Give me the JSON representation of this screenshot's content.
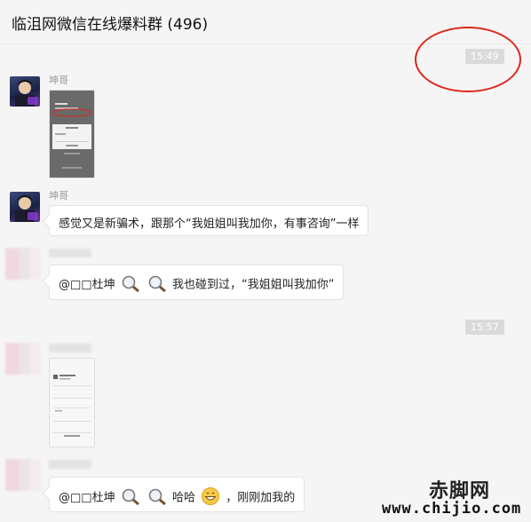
{
  "header": {
    "title": "临沮网微信在线爆料群 (496)"
  },
  "timestamps": [
    "15:49",
    "15:57"
  ],
  "messages": [
    {
      "sender": "坤哥",
      "type": "image"
    },
    {
      "sender": "坤哥",
      "type": "text",
      "text": "感觉又是新骗术，跟那个“我姐姐叫我加你，有事咨询”一样"
    },
    {
      "sender": "",
      "type": "text",
      "mention": "@□□杜坤",
      "text": "我也碰到过，“我姐姐叫我加你”",
      "icons": [
        "magnifier-icon",
        "magnifier-icon"
      ]
    },
    {
      "sender": "",
      "type": "image"
    },
    {
      "sender": "",
      "type": "text",
      "mention": "@□□杜坤",
      "text_a": "哈哈",
      "text_b": "，刚刚加我的",
      "icons": [
        "magnifier-icon",
        "magnifier-icon",
        "grin-emoji-icon"
      ]
    }
  ],
  "watermark": {
    "cn": "赤脚网",
    "url": "www.chijio.com"
  },
  "colors": {
    "annotation": "#e0251b",
    "background": "#f5f5f5",
    "bubble": "#ffffff"
  }
}
